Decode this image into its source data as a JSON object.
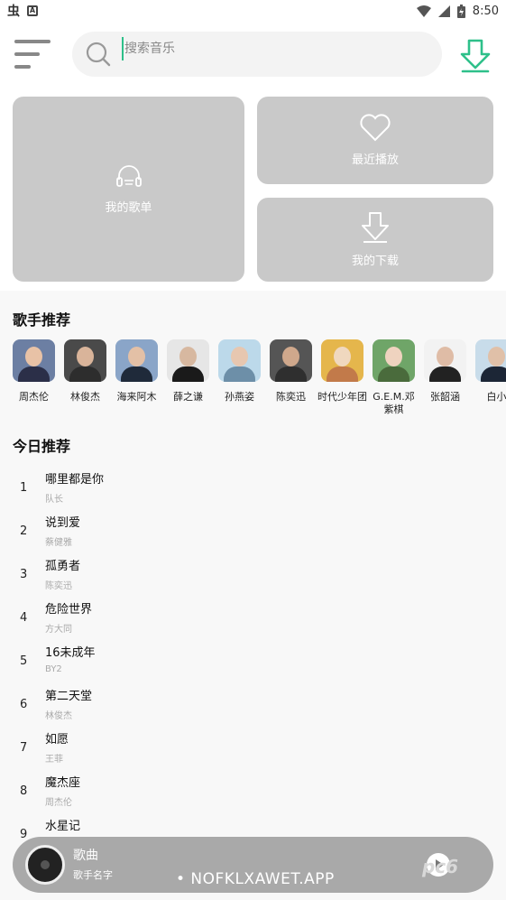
{
  "status_bar": {
    "time": "8:50",
    "left_glyph": "虫",
    "box_letter": "A"
  },
  "search": {
    "placeholder": "搜索音乐"
  },
  "tiles": {
    "playlist": "我的歌单",
    "recent": "最近播放",
    "downloads": "我的下载"
  },
  "sections": {
    "singers_title": "歌手推荐",
    "today_title": "今日推荐"
  },
  "singers": [
    {
      "name": "周杰伦",
      "colors": [
        "#6c7fa3",
        "#e8c2a6",
        "#2b2f48"
      ]
    },
    {
      "name": "林俊杰",
      "colors": [
        "#4a4a4a",
        "#d9b49a",
        "#2d2d2d"
      ]
    },
    {
      "name": "海来阿木",
      "colors": [
        "#8aa5c8",
        "#e3c0a6",
        "#1f2a3a"
      ]
    },
    {
      "name": "薛之谦",
      "colors": [
        "#e6e6e6",
        "#d7b8a0",
        "#1a1a1a"
      ]
    },
    {
      "name": "孙燕姿",
      "colors": [
        "#bcd9ea",
        "#e7c7b0",
        "#6d8fa8"
      ]
    },
    {
      "name": "陈奕迅",
      "colors": [
        "#555555",
        "#cfa88c",
        "#2f2f2f"
      ]
    },
    {
      "name": "时代少年团",
      "colors": [
        "#e5b64c",
        "#f0d8bf",
        "#c27a4a"
      ]
    },
    {
      "name": "G.E.M.邓紫棋",
      "colors": [
        "#6fa568",
        "#efd3bf",
        "#4a6b3c"
      ]
    },
    {
      "name": "张韶涵",
      "colors": [
        "#f2f2f2",
        "#dfbca6",
        "#222222"
      ]
    },
    {
      "name": "白小",
      "colors": [
        "#c8dcea",
        "#e0c0a8",
        "#1c2636"
      ]
    }
  ],
  "songs": [
    {
      "num": "1",
      "title": "哪里都是你",
      "artist": "队长"
    },
    {
      "num": "2",
      "title": "说到爱",
      "artist": "蔡健雅"
    },
    {
      "num": "3",
      "title": "孤勇者",
      "artist": "陈奕迅"
    },
    {
      "num": "4",
      "title": "危险世界",
      "artist": "方大同"
    },
    {
      "num": "5",
      "title": "16未成年",
      "artist": "BY2"
    },
    {
      "num": "6",
      "title": "第二天堂",
      "artist": "林俊杰"
    },
    {
      "num": "7",
      "title": "如愿",
      "artist": "王菲"
    },
    {
      "num": "8",
      "title": "魔杰座",
      "artist": "周杰伦"
    },
    {
      "num": "9",
      "title": "水星记",
      "artist": ""
    }
  ],
  "player": {
    "title": "歌曲",
    "artist": "歌手名字"
  },
  "watermark": "• NOFKLXAWET.APP",
  "watermark2": "pc6",
  "colors": {
    "accent": "#2ec08a",
    "tile": "#c9c9c9",
    "player": "#a9a9a9"
  }
}
